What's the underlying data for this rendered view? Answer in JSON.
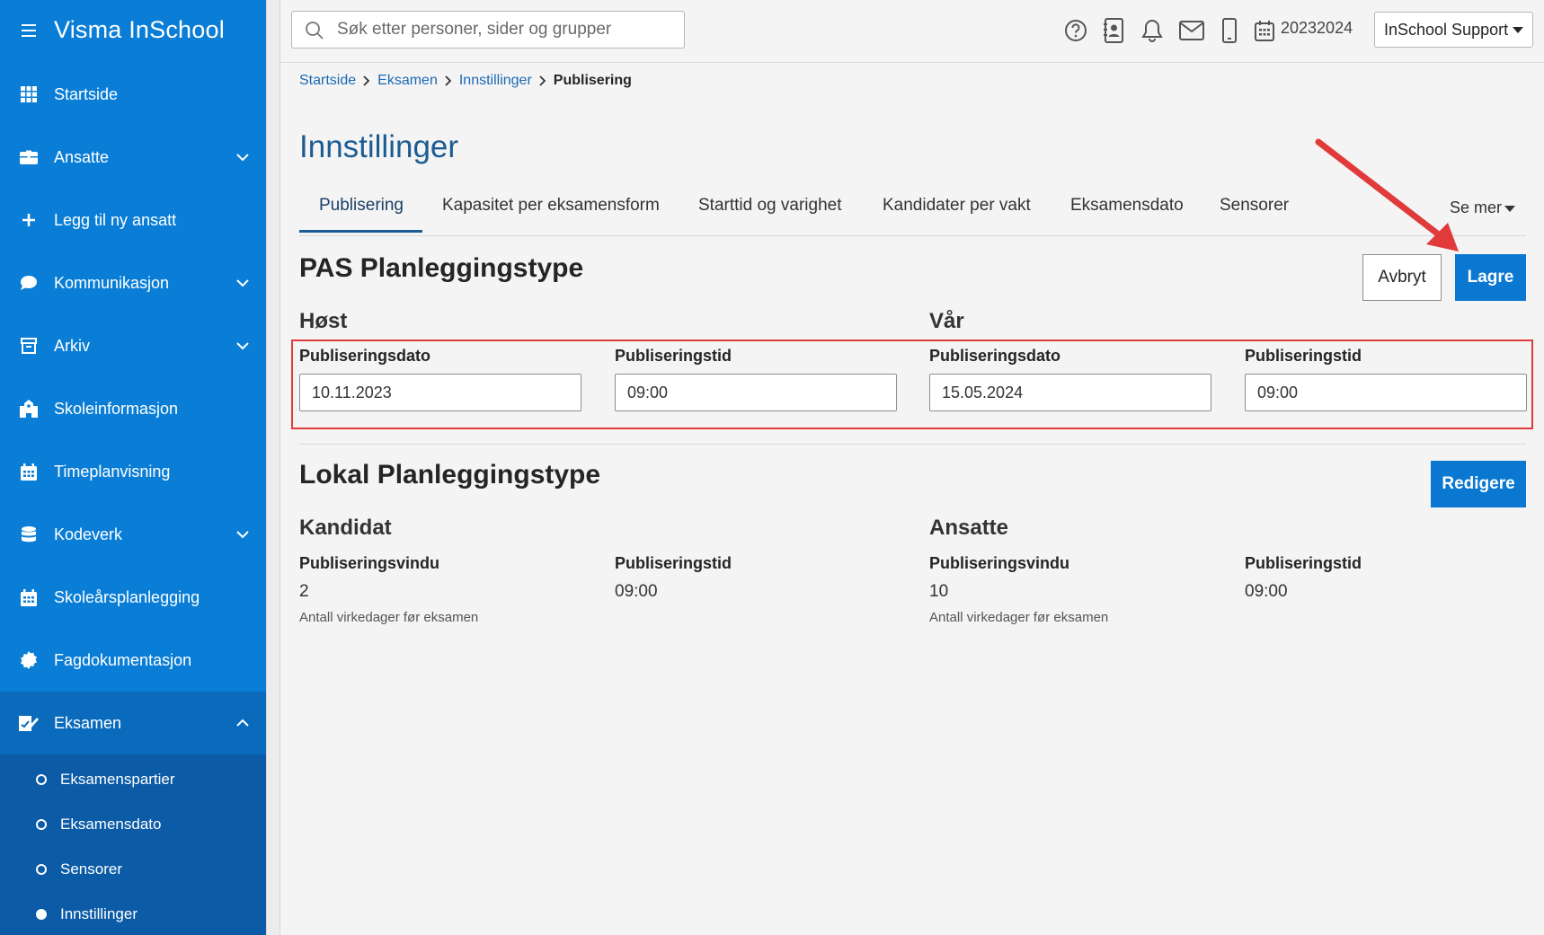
{
  "app": {
    "title": "Visma InSchool"
  },
  "sidebar": {
    "items": [
      {
        "label": "Startside",
        "icon": "grid-icon",
        "has_chevron": false
      },
      {
        "label": "Ansatte",
        "icon": "briefcase-icon",
        "has_chevron": true
      },
      {
        "label": "Legg til ny ansatt",
        "icon": "plus-icon",
        "has_chevron": false
      },
      {
        "label": "Kommunikasjon",
        "icon": "chat-bubble-icon",
        "has_chevron": true
      },
      {
        "label": "Arkiv",
        "icon": "archive-box-icon",
        "has_chevron": true
      },
      {
        "label": "Skoleinformasjon",
        "icon": "school-building-icon",
        "has_chevron": false
      },
      {
        "label": "Timeplanvisning",
        "icon": "calendar-icon",
        "has_chevron": false
      },
      {
        "label": "Kodeverk",
        "icon": "database-icon",
        "has_chevron": true
      },
      {
        "label": "Skoleårsplanlegging",
        "icon": "calendar-icon",
        "has_chevron": false
      },
      {
        "label": "Fagdokumentasjon",
        "icon": "badge-seal-icon",
        "has_chevron": false
      },
      {
        "label": "Eksamen",
        "icon": "exam-edit-icon",
        "has_chevron": true,
        "expanded": true
      }
    ],
    "sub_items": [
      {
        "label": "Eksamenspartier",
        "selected": false
      },
      {
        "label": "Eksamensdato",
        "selected": false
      },
      {
        "label": "Sensorer",
        "selected": false
      },
      {
        "label": "Innstillinger",
        "selected": true
      }
    ]
  },
  "topbar": {
    "search_placeholder": "Søk etter personer, sider og grupper",
    "icons": [
      "help-circle-icon",
      "contact-card-icon",
      "bell-icon",
      "mail-icon",
      "mobile-phone-icon",
      "calendar-icon"
    ],
    "school_year": "20232024",
    "user_menu": "InSchool Support"
  },
  "breadcrumb": {
    "items": [
      "Startside",
      "Eksamen",
      "Innstillinger"
    ],
    "current": "Publisering"
  },
  "page": {
    "title": "Innstillinger",
    "tabs": [
      "Publisering",
      "Kapasitet per eksamensform",
      "Starttid og varighet",
      "Kandidater per vakt",
      "Eksamensdato",
      "Sensorer"
    ],
    "active_tab": "Publisering",
    "more_label": "Se mer"
  },
  "pas": {
    "title": "PAS Planleggingstype",
    "cancel_label": "Avbryt",
    "save_label": "Lagre",
    "autumn": {
      "title": "Høst",
      "date_label": "Publiseringsdato",
      "date_value": "10.11.2023",
      "time_label": "Publiseringstid",
      "time_value": "09:00"
    },
    "spring": {
      "title": "Vår",
      "date_label": "Publiseringsdato",
      "date_value": "15.05.2024",
      "time_label": "Publiseringstid",
      "time_value": "09:00"
    }
  },
  "local": {
    "title": "Lokal Planleggingstype",
    "edit_label": "Redigere",
    "candidate": {
      "title": "Kandidat",
      "window_label": "Publiseringsvindu",
      "window_value": "2",
      "window_help": "Antall virkedager før eksamen",
      "time_label": "Publiseringstid",
      "time_value": "09:00"
    },
    "staff": {
      "title": "Ansatte",
      "window_label": "Publiseringsvindu",
      "window_value": "10",
      "window_help": "Antall virkedager før eksamen",
      "time_label": "Publiseringstid",
      "time_value": "09:00"
    }
  },
  "colors": {
    "sidebar": "#0a7ed6",
    "sidebar_sub": "#0b5ba7",
    "primary_button": "#0a78d1",
    "title": "#1c5c93",
    "annotation": "#e03a3a"
  }
}
